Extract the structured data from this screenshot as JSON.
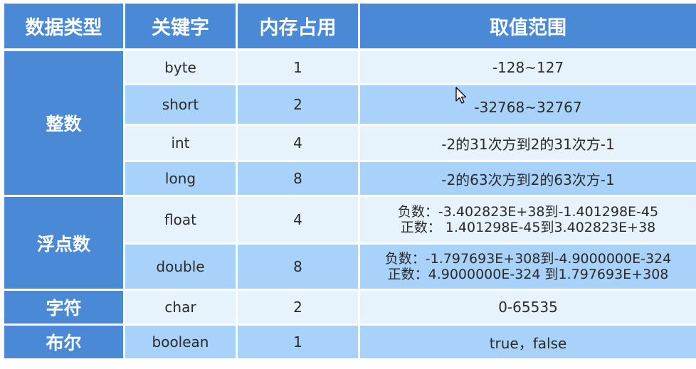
{
  "headers": [
    "数据类型",
    "关键字",
    "内存占用",
    "取值范围"
  ],
  "categories": {
    "integer": "整数",
    "float": "浮点数",
    "char": "字符",
    "boolean": "布尔"
  },
  "rows": [
    {
      "keyword": "byte",
      "size": "1",
      "range": "-128~127"
    },
    {
      "keyword": "short",
      "size": "2",
      "range": "-32768~32767"
    },
    {
      "keyword": "int",
      "size": "4",
      "range": "-2的31次方到2的31次方-1"
    },
    {
      "keyword": "long",
      "size": "8",
      "range": "-2的63次方到2的63次方-1"
    },
    {
      "keyword": "float",
      "size": "4",
      "range_neg": "负数：-3.402823E+38到-1.401298E-45",
      "range_pos": "正数： 1.401298E-45到3.402823E+38"
    },
    {
      "keyword": "double",
      "size": "8",
      "range_neg": "负数：-1.797693E+308到-4.9000000E-324",
      "range_pos": "正数：4.9000000E-324 到1.797693E+308"
    },
    {
      "keyword": "char",
      "size": "2",
      "range": "0-65535"
    },
    {
      "keyword": "boolean",
      "size": "1",
      "range": "true，false"
    }
  ],
  "colors": {
    "header_bg": "#4a89d6",
    "row_light": "#e6f2fc",
    "row_dark": "#a9d2fb"
  }
}
